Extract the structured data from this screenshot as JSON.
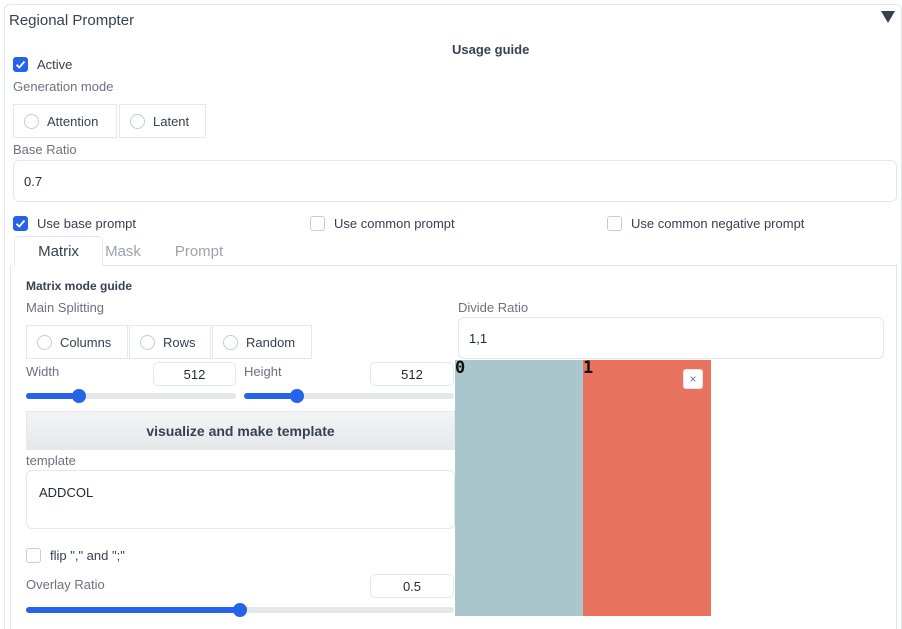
{
  "panel": {
    "title": "Regional Prompter",
    "usage_guide": "Usage guide"
  },
  "active": {
    "label": "Active",
    "checked": true
  },
  "generation_mode": {
    "label": "Generation mode",
    "options": [
      "Attention",
      "Latent"
    ]
  },
  "base_ratio": {
    "label": "Base Ratio",
    "value": "0.7"
  },
  "checkboxes": {
    "use_base_prompt": {
      "label": "Use base prompt",
      "checked": true
    },
    "use_common_prompt": {
      "label": "Use common prompt",
      "checked": false
    },
    "use_common_negative_prompt": {
      "label": "Use common negative prompt",
      "checked": false
    }
  },
  "tabs": [
    "Matrix",
    "Mask",
    "Prompt"
  ],
  "matrix": {
    "guide": "Matrix mode guide",
    "main_splitting": {
      "label": "Main Splitting",
      "options": [
        "Columns",
        "Rows",
        "Random"
      ]
    },
    "divide_ratio": {
      "label": "Divide Ratio",
      "value": "1,1"
    },
    "width": {
      "label": "Width",
      "value": "512",
      "fraction": 0.25
    },
    "height": {
      "label": "Height",
      "value": "512",
      "fraction": 0.25
    },
    "visualize_button": "visualize and make template",
    "template": {
      "label": "template",
      "value": "ADDCOL"
    },
    "flip": {
      "label": "flip \",\" and \";\"",
      "checked": false
    },
    "overlay_ratio": {
      "label": "Overlay Ratio",
      "value": "0.5",
      "fraction": 0.5
    },
    "preview": {
      "labels": [
        "0",
        "1"
      ],
      "colors": [
        "#a8c6cb",
        "#e8735e"
      ],
      "close": "×"
    }
  },
  "colors": {
    "accent": "#2563eb"
  }
}
